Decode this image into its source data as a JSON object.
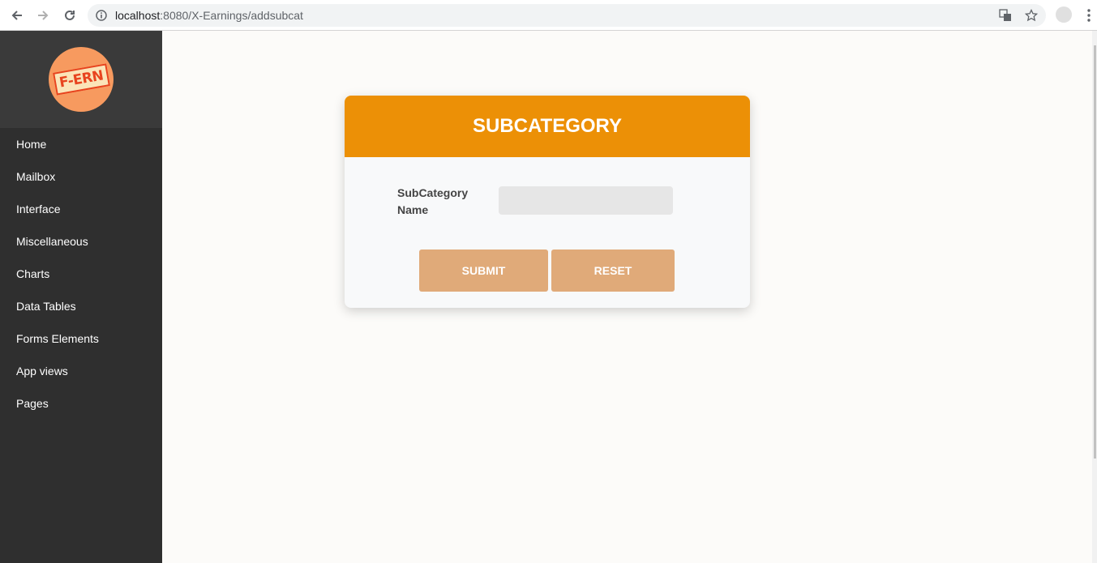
{
  "browser": {
    "url_host": "localhost",
    "url_rest": ":8080/X-Earnings/addsubcat"
  },
  "sidebar": {
    "logo_text": "F-ERN",
    "items": [
      {
        "label": "Home"
      },
      {
        "label": "Mailbox"
      },
      {
        "label": "Interface"
      },
      {
        "label": "Miscellaneous"
      },
      {
        "label": "Charts"
      },
      {
        "label": "Data Tables"
      },
      {
        "label": "Forms Elements"
      },
      {
        "label": "App views"
      },
      {
        "label": "Pages"
      }
    ]
  },
  "form": {
    "title": "SUBCATEGORY",
    "field_label": "SubCategory Name",
    "field_value": "",
    "submit_label": "SUBMIT",
    "reset_label": "RESET"
  },
  "colors": {
    "header": "#ec9006",
    "button": "#e0aa79",
    "sidebar": "#2f2f2f"
  }
}
